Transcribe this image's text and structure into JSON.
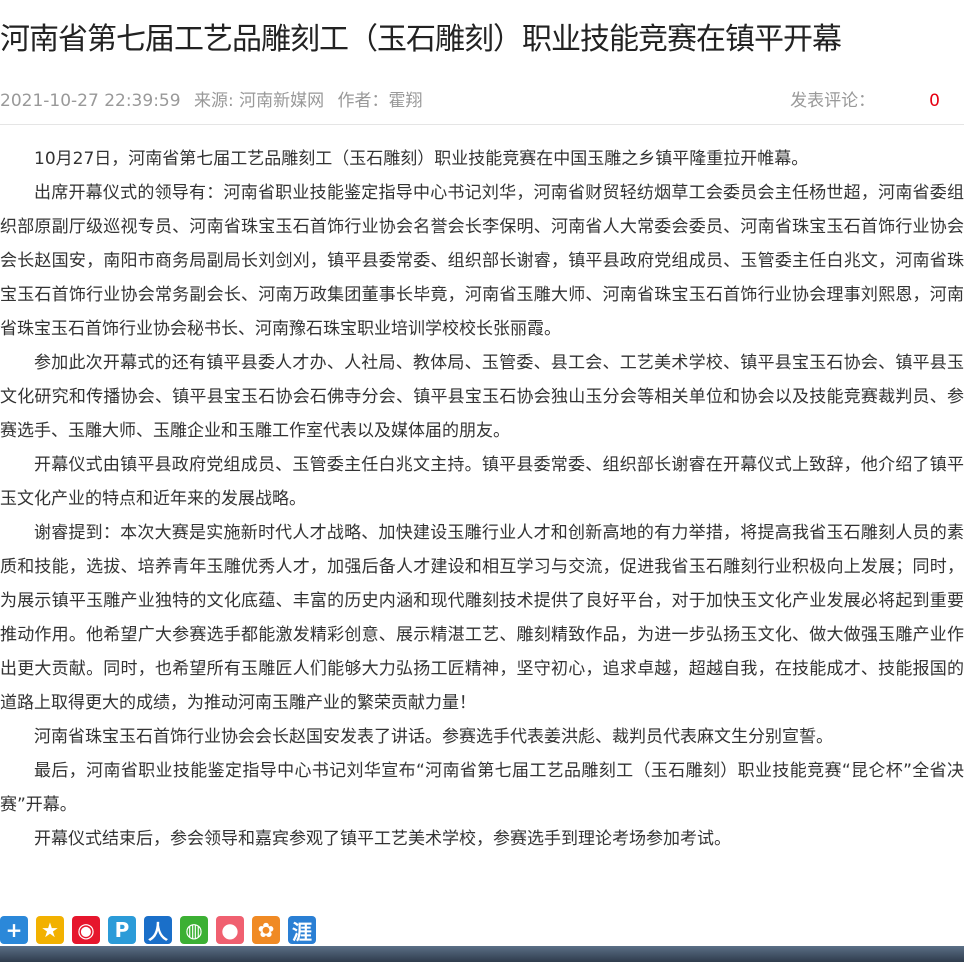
{
  "article": {
    "title": "河南省第七届工艺品雕刻工（玉石雕刻）职业技能竞赛在镇平开幕",
    "meta": {
      "datetime": "2021-10-27 22:39:59",
      "source": "来源: 河南新媒网",
      "author": "作者：霍翔",
      "comment_label": "发表评论：",
      "comment_count": "0"
    },
    "paragraphs": [
      "10月27日，河南省第七届工艺品雕刻工（玉石雕刻）职业技能竞赛在中国玉雕之乡镇平隆重拉开帷幕。",
      "出席开幕仪式的领导有：河南省职业技能鉴定指导中心书记刘华，河南省财贸轻纺烟草工会委员会主任杨世超，河南省委组织部原副厅级巡视专员、河南省珠宝玉石首饰行业协会名誉会长李保明、河南省人大常委会委员、河南省珠宝玉石首饰行业协会会长赵国安，南阳市商务局副局长刘剑刈，镇平县委常委、组织部长谢睿，镇平县政府党组成员、玉管委主任白兆文，河南省珠宝玉石首饰行业协会常务副会长、河南万政集团董事长毕竟，河南省玉雕大师、河南省珠宝玉石首饰行业协会理事刘熙恩，河南省珠宝玉石首饰行业协会秘书长、河南豫石珠宝职业培训学校校长张丽霞。",
      "参加此次开幕式的还有镇平县委人才办、人社局、教体局、玉管委、县工会、工艺美术学校、镇平县宝玉石协会、镇平县玉文化研究和传播协会、镇平县宝玉石协会石佛寺分会、镇平县宝玉石协会独山玉分会等相关单位和协会以及技能竞赛裁判员、参赛选手、玉雕大师、玉雕企业和玉雕工作室代表以及媒体届的朋友。",
      "开幕仪式由镇平县政府党组成员、玉管委主任白兆文主持。镇平县委常委、组织部长谢睿在开幕仪式上致辞，他介绍了镇平玉文化产业的特点和近年来的发展战略。",
      "谢睿提到：本次大赛是实施新时代人才战略、加快建设玉雕行业人才和创新高地的有力举措，将提高我省玉石雕刻人员的素质和技能，选拔、培养青年玉雕优秀人才，加强后备人才建设和相互学习与交流，促进我省玉石雕刻行业积极向上发展；同时，为展示镇平玉雕产业独特的文化底蕴、丰富的历史内涵和现代雕刻技术提供了良好平台，对于加快玉文化产业发展必将起到重要推动作用。他希望广大参赛选手都能激发精彩创意、展示精湛工艺、雕刻精致作品，为进一步弘扬玉文化、做大做强玉雕产业作出更大贡献。同时，也希望所有玉雕匠人们能够大力弘扬工匠精神，坚守初心，追求卓越，超越自我，在技能成才、技能报国的道路上取得更大的成绩，为推动河南玉雕产业的繁荣贡献力量！",
      "河南省珠宝玉石首饰行业协会会长赵国安发表了讲话。参赛选手代表姜洪彪、裁判员代表麻文生分别宣誓。",
      "最后，河南省职业技能鉴定指导中心书记刘华宣布“河南省第七届工艺品雕刻工（玉石雕刻）职业技能竞赛“昆仑杯”全省决赛”开幕。",
      "开幕仪式结束后，参会领导和嘉宾参观了镇平工艺美术学校，参赛选手到理论考场参加考试。"
    ]
  },
  "share": {
    "buttons": [
      {
        "name": "share-more-icon",
        "glyph": "+",
        "color": "#2b88d9"
      },
      {
        "name": "share-qzone-icon",
        "glyph": "★",
        "color": "#f2b100"
      },
      {
        "name": "share-weibo-icon",
        "glyph": "◉",
        "color": "#e6162d"
      },
      {
        "name": "share-pengyou-icon",
        "glyph": "P",
        "color": "#2b9bd8"
      },
      {
        "name": "share-renren-icon",
        "glyph": "人",
        "color": "#1a6fc9"
      },
      {
        "name": "share-wechat-icon",
        "glyph": "◍",
        "color": "#3cb034"
      },
      {
        "name": "share-douban-icon",
        "glyph": "●",
        "color": "#f06070"
      },
      {
        "name": "share-kaixin-icon",
        "glyph": "✿",
        "color": "#f08a24"
      },
      {
        "name": "share-yixin-icon",
        "glyph": "涯",
        "color": "#2a7fd4"
      }
    ]
  }
}
